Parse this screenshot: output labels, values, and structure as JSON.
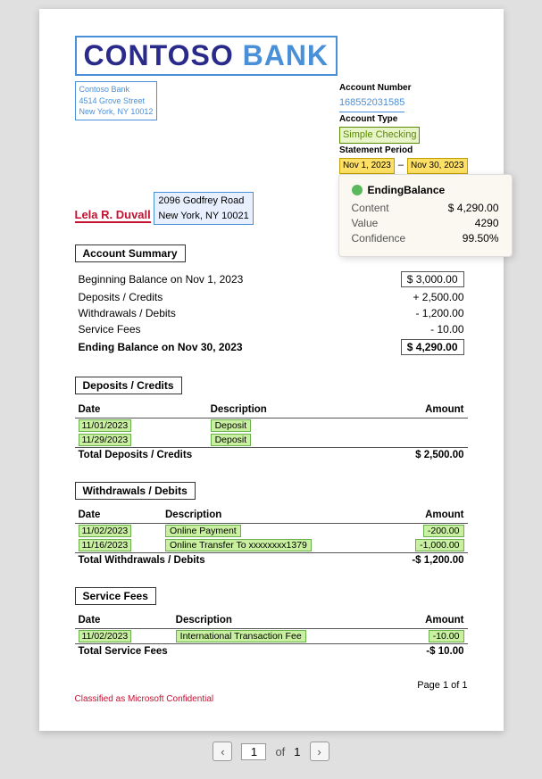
{
  "bank": {
    "name_con": "CONTOSO",
    "name_bank": "BANK",
    "address_line1": "Contoso Bank",
    "address_line2": "4514 Grove Street",
    "address_line3": "New York, NY 10012"
  },
  "account": {
    "number_label": "Account Number",
    "number_value": "168552031585",
    "type_label": "Account Type",
    "type_value": "Simple Checking",
    "period_label": "Statement Period",
    "period_start": "Nov 1, 2023",
    "period_dash": "–",
    "period_end": "Nov 30, 2023"
  },
  "recipient": {
    "name": "Lela R. Duvall",
    "address_line1": "2096 Godfrey Road",
    "address_line2": "New York, NY 10021"
  },
  "account_summary": {
    "title": "Account Summary",
    "rows": [
      {
        "label": "Beginning Balance on Nov 1, 2023",
        "amount": "$ 3,000.00",
        "highlighted": true
      },
      {
        "label": "Deposits / Credits",
        "amount": "+ 2,500.00",
        "highlighted": false
      },
      {
        "label": "Withdrawals / Debits",
        "amount": "- 1,200.00",
        "highlighted": false
      },
      {
        "label": "Service Fees",
        "amount": "- 10.00",
        "highlighted": false
      }
    ],
    "ending_label": "Ending Balance on Nov 30, 2023",
    "ending_amount": "$ 4,290.00"
  },
  "deposits": {
    "title": "Deposits / Credits",
    "columns": [
      "Date",
      "Description",
      "Amount"
    ],
    "rows": [
      {
        "date": "11/01/2023",
        "description": "Deposit",
        "amount": ""
      },
      {
        "date": "11/29/2023",
        "description": "Deposit",
        "amount": ""
      }
    ],
    "total_label": "Total Deposits / Credits",
    "total_amount": "$ 2,500.00"
  },
  "withdrawals": {
    "title": "Withdrawals / Debits",
    "columns": [
      "Date",
      "Description",
      "Amount"
    ],
    "rows": [
      {
        "date": "11/02/2023",
        "description": "Online Payment",
        "amount": "-200.00"
      },
      {
        "date": "11/16/2023",
        "description": "Online Transfer To xxxxxxxx1379",
        "amount": "-1,000.00"
      }
    ],
    "total_label": "Total Withdrawals / Debits",
    "total_amount": "-$ 1,200.00"
  },
  "service_fees": {
    "title": "Service Fees",
    "columns": [
      "Date",
      "Description",
      "Amount"
    ],
    "rows": [
      {
        "date": "11/02/2023",
        "description": "International Transaction Fee",
        "amount": "-10.00"
      }
    ],
    "total_label": "Total Service Fees",
    "total_amount": "-$ 10.00"
  },
  "tooltip": {
    "title": "EndingBalance",
    "content_label": "Content",
    "content_value": "$ 4,290.00",
    "value_label": "Value",
    "value_value": "4290",
    "confidence_label": "Confidence",
    "confidence_value": "99.50%"
  },
  "footer": {
    "page_text": "Page 1 of 1",
    "confidential": "Classified as Microsoft Confidential"
  },
  "pagination": {
    "current": "1",
    "of_label": "of",
    "total": "1",
    "prev_icon": "‹",
    "next_icon": "›"
  }
}
